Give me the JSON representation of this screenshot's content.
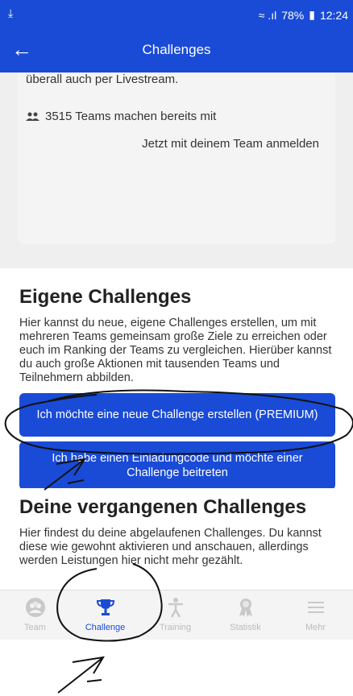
{
  "statusbar": {
    "left_icon": "download-icon",
    "signal": "≈ .ıl",
    "battery_percent": "78%",
    "time": "12:24"
  },
  "appbar": {
    "back_icon": "arrow-left-icon",
    "title": "Challenges"
  },
  "top_card": {
    "line1": "überall auch per Livestream.",
    "teams_count_text": "3515 Teams machen bereits mit",
    "join_link": "Jetzt mit deinem Team anmelden"
  },
  "own_challenges": {
    "heading": "Eigene Challenges",
    "description": "Hier kannst du neue, eigene Challenges erstellen, um mit mehreren Teams gemeinsam große Ziele zu erreichen oder euch im Ranking der Teams zu vergleichen. Hierüber kannst du auch große Aktionen mit tausenden Teams und Teilnehmern abbilden.",
    "create_button": "Ich möchte eine neue Challenge erstellen (PREMIUM)",
    "join_button": "Ich habe einen Einladungcode und möchte einer Challenge beitreten"
  },
  "past_challenges": {
    "heading": "Deine vergangenen Challenges",
    "description": "Hier findest du deine abgelaufenen Challenges. Du kannst diese wie gewohnt aktivieren und anschauen, allerdings werden Leistungen hier nicht mehr gezählt."
  },
  "tabbar": {
    "tabs": [
      {
        "label": "Team",
        "icon": "team-icon",
        "active": false
      },
      {
        "label": "Challenge",
        "icon": "trophy-icon",
        "active": true
      },
      {
        "label": "Training",
        "icon": "person-icon",
        "active": false
      },
      {
        "label": "Statistik",
        "icon": "medal-icon",
        "active": false
      },
      {
        "label": "Mehr",
        "icon": "menu-icon",
        "active": false
      }
    ]
  },
  "colors": {
    "primary": "#1a4bd6",
    "background": "#efefef",
    "tab_inactive": "#bbbbbb"
  }
}
